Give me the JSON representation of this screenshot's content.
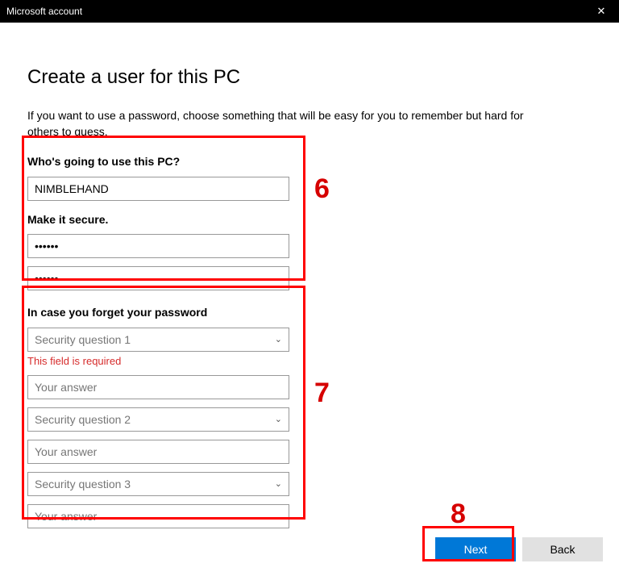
{
  "window": {
    "title": "Microsoft account"
  },
  "page": {
    "heading": "Create a user for this PC",
    "description": "If you want to use a password, choose something that will be easy for you to remember but hard for others to guess."
  },
  "userSection": {
    "whoLabel": "Who's going to use this PC?",
    "usernameValue": "NIMBLEHAND",
    "secureLabel": "Make it secure.",
    "passwordMasked": "••••••",
    "confirmMasked": "••••••"
  },
  "securitySection": {
    "heading": "In case you forget your password",
    "questions": [
      {
        "placeholder": "Security question 1"
      },
      {
        "placeholder": "Security question 2"
      },
      {
        "placeholder": "Security question 3"
      }
    ],
    "errorText": "This field is required",
    "answerPlaceholder": "Your answer"
  },
  "footer": {
    "nextLabel": "Next",
    "backLabel": "Back"
  },
  "annotations": {
    "a6": "6",
    "a7": "7",
    "a8": "8"
  }
}
